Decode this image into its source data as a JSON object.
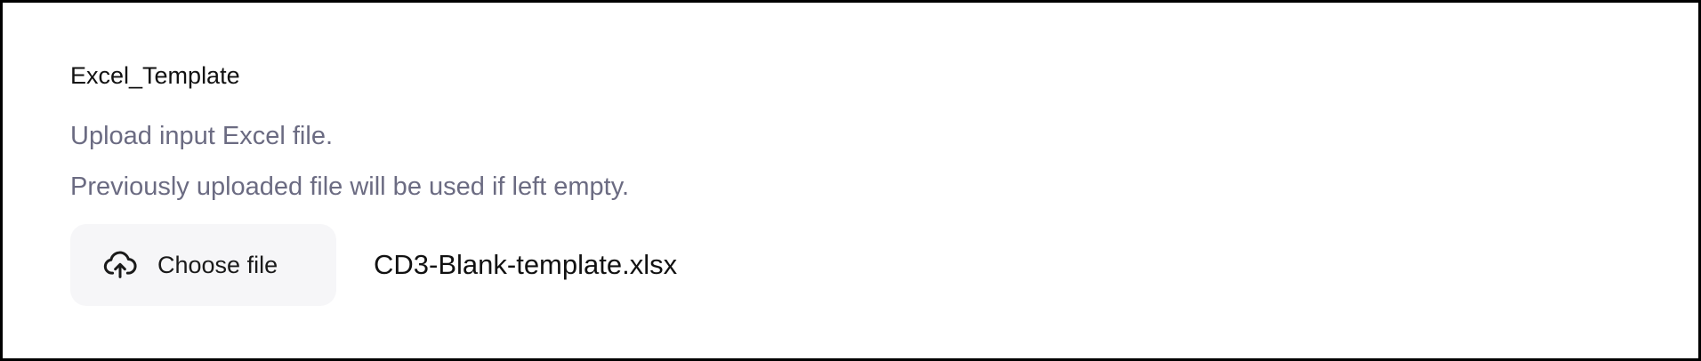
{
  "field": {
    "title": "Excel_Template",
    "help_lines": [
      "Upload input Excel file.",
      "Previously uploaded file will be used if left empty."
    ]
  },
  "upload": {
    "button_label": "Choose file",
    "button_icon": "cloud-upload-icon",
    "selected_file": "CD3-Blank-template.xlsx"
  },
  "colors": {
    "title": "#111111",
    "help_text": "#6b6b82",
    "button_bg": "#f6f6f8",
    "border": "#000000"
  }
}
